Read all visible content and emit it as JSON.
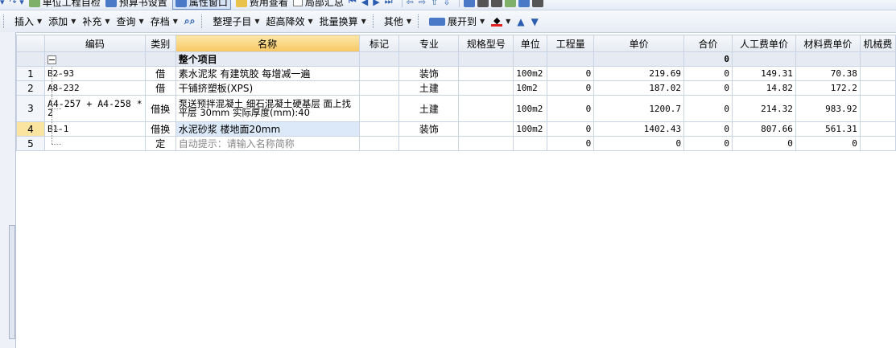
{
  "toolbar_top": {
    "items": [
      "单位工程自检",
      "预算书设置",
      "属性窗口",
      "费用查看",
      "局部汇总"
    ]
  },
  "toolbar": {
    "items": [
      {
        "label": "插入",
        "dropdown": true
      },
      {
        "label": "添加",
        "dropdown": true
      },
      {
        "label": "补充",
        "dropdown": true
      },
      {
        "label": "查询",
        "dropdown": true
      },
      {
        "label": "存档",
        "dropdown": true
      },
      {
        "label": "整理子目",
        "dropdown": true
      },
      {
        "label": "超高降效",
        "dropdown": true
      },
      {
        "label": "批量换算",
        "dropdown": true
      },
      {
        "label": "其他",
        "dropdown": true
      },
      {
        "label": "展开到",
        "dropdown": true
      }
    ]
  },
  "grid": {
    "columns": [
      "",
      "编码",
      "类别",
      "名称",
      "标记",
      "专业",
      "规格型号",
      "单位",
      "工程量",
      "单价",
      "合价",
      "人工费单价",
      "材料费单价",
      "机械费"
    ],
    "group_row": {
      "name": "整个项目",
      "total": "0"
    },
    "rows": [
      {
        "num": "1",
        "code": "B2-93",
        "type": "借",
        "name": "素水泥浆 有建筑胶 每增减一遍",
        "mark": "",
        "spec_major": "装饰",
        "model": "",
        "unit": "100m2",
        "qty": "0",
        "price": "219.69",
        "total": "0",
        "labor": "149.31",
        "material": "70.38"
      },
      {
        "num": "2",
        "code": "A8-232",
        "type": "借",
        "name": "干铺挤塑板(XPS)",
        "mark": "",
        "spec_major": "土建",
        "model": "",
        "unit": "10m2",
        "qty": "0",
        "price": "187.02",
        "total": "0",
        "labor": "14.82",
        "material": "172.2"
      },
      {
        "num": "3",
        "code": "A4-257 + A4-258 * 2",
        "type": "借换",
        "name": "泵送预拌混凝土 细石混凝土硬基层 面上找平层 30mm  实际厚度(mm):40",
        "mark": "",
        "spec_major": "土建",
        "model": "",
        "unit": "100m2",
        "qty": "0",
        "price": "1200.7",
        "total": "0",
        "labor": "214.32",
        "material": "983.92"
      },
      {
        "num": "4",
        "code": "B1-1",
        "type": "借换",
        "name": "水泥砂浆 楼地面20mm",
        "mark": "",
        "spec_major": "装饰",
        "model": "",
        "unit": "100m2",
        "qty": "0",
        "price": "1402.43",
        "total": "0",
        "labor": "807.66",
        "material": "561.31"
      },
      {
        "num": "5",
        "code": "",
        "type": "定",
        "name": "自动提示：请输入名称简称",
        "mark": "",
        "spec_major": "",
        "model": "",
        "unit": "",
        "qty": "0",
        "price": "0",
        "total": "0",
        "labor": "0",
        "material": "0"
      }
    ]
  }
}
